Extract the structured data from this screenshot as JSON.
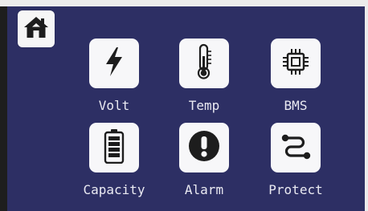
{
  "theme": {
    "background": "#2d2f64",
    "tile": "#f7f7f9",
    "icon": "#1d1d1d",
    "label": "#eaeaf2"
  },
  "header": {
    "home_icon": "home-icon"
  },
  "tiles": [
    {
      "label": "Volt",
      "icon": "lightning-bolt-icon"
    },
    {
      "label": "Temp",
      "icon": "thermometer-icon"
    },
    {
      "label": "BMS",
      "icon": "chip-icon"
    },
    {
      "label": "Capacity",
      "icon": "battery-icon"
    },
    {
      "label": "Alarm",
      "icon": "alarm-exclamation-icon"
    },
    {
      "label": "Protect",
      "icon": "protect-route-icon"
    }
  ]
}
